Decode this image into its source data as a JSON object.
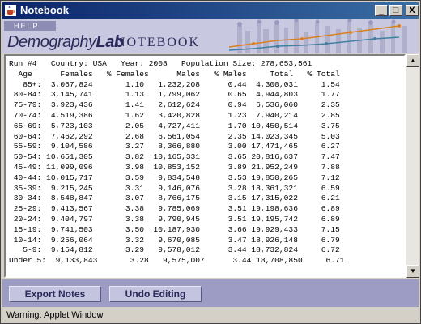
{
  "window": {
    "title": "Notebook",
    "minimize_label": "_",
    "maximize_label": "□",
    "close_label": "X"
  },
  "header": {
    "help_label": "HELP",
    "logo_main": "Demography",
    "logo_bold": "Lab",
    "logo_sub": "NOTEBOOK"
  },
  "notes": {
    "text": "Run #4   Country: USA   Year: 2008   Population Size: 278,653,561\n  Age      Females   % Females      Males   % Males     Total   % Total\n   85+:  3,067,824       1.10   1,232,208      0.44  4,300,031     1.54\n 80-84:  3,145,741       1.13   1,799,062      0.65  4,944,803     1.77\n 75-79:  3,923,436       1.41   2,612,624      0.94  6,536,060     2.35\n 70-74:  4,519,386       1.62   3,420,828      1.23  7,940,214     2.85\n 65-69:  5,723,103       2.05   4,727,411      1.70 10,450,514     3.75\n 60-64:  7,462,292       2.68   6,561,054      2.35 14,023,345     5.03\n 55-59:  9,104,586       3.27   8,366,880      3.00 17,471,465     6.27\n 50-54: 10,651,305       3.82  10,165,331      3.65 20,816,637     7.47\n 45-49: 11,099,096       3.98  10,853,152      3.89 21,952,249     7.88\n 40-44: 10,015,717       3.59   9,834,548      3.53 19,850,265     7.12\n 35-39:  9,215,245       3.31   9,146,076      3.28 18,361,321     6.59\n 30-34:  8,548,847       3.07   8,766,175      3.15 17,315,022     6.21\n 25-29:  9,413,567       3.38   9,785,069      3.51 19,198,636     6.89\n 20-24:  9,404,797       3.38   9,790,945      3.51 19,195,742     6.89\n 15-19:  9,741,503       3.50  10,187,930      3.66 19,929,433     7.15\n 10-14:  9,256,064       3.32   9,670,085      3.47 18,926,148     6.79\n   5-9:  9,154,812       3.29   9,578,012      3.44 18,732,824     6.72\nUnder 5:  9,133,843       3.28   9,575,007      3.44 18,708,850     6.71\n\nThere is a large proportion of adults reaching retirement age."
  },
  "scrollbar": {
    "up_label": "▲",
    "down_label": "▼"
  },
  "actions": {
    "export_label": "Export Notes",
    "undo_label": "Undo Editing"
  },
  "status": {
    "text": "Warning: Applet Window"
  },
  "colors": {
    "titlebar": "#0a246a",
    "header_bg": "#c8c8e0",
    "bottom_panel": "#9c9cc4",
    "button_face": "#c4c4e0",
    "brand_text": "#2a2a5a"
  }
}
